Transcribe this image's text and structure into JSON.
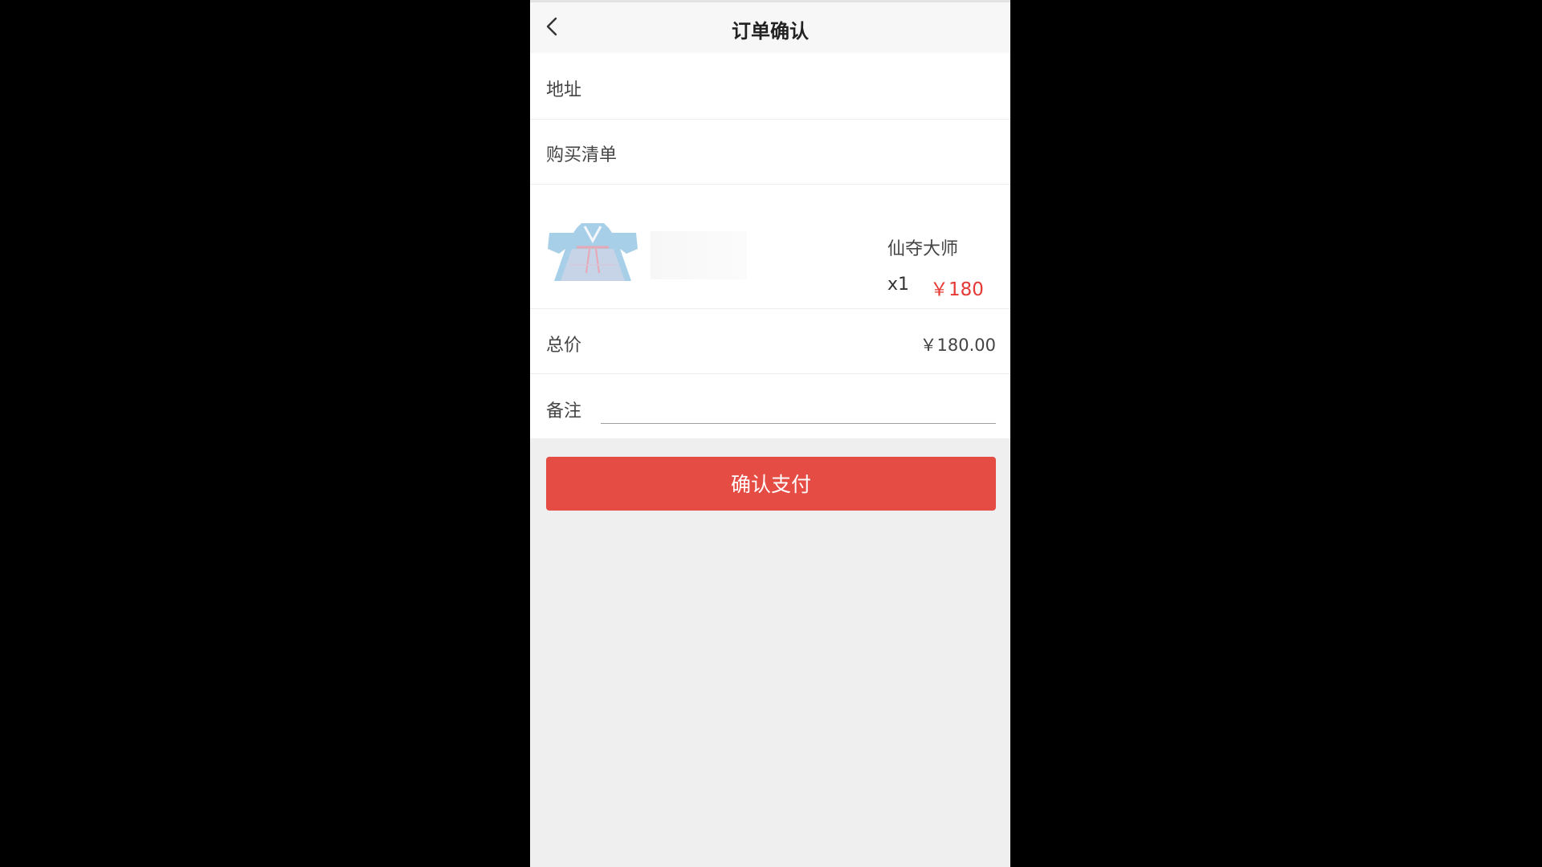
{
  "header": {
    "title": "订单确认",
    "back_icon": "chevron-left-icon"
  },
  "address": {
    "label": "地址"
  },
  "purchase_list": {
    "label": "购买清单",
    "items": [
      {
        "name": "仙夺大师",
        "quantity": "x1",
        "price": "￥180",
        "image_icon": "hanfu-dress-image"
      }
    ]
  },
  "total": {
    "label": "总价",
    "value": "￥180.00"
  },
  "note": {
    "label": "备注",
    "value": ""
  },
  "pay_button": {
    "label": "确认支付"
  },
  "colors": {
    "accent": "#e54c44",
    "price": "#e53935",
    "page_bg": "#f0eff0",
    "outer_bg": "#000000"
  }
}
